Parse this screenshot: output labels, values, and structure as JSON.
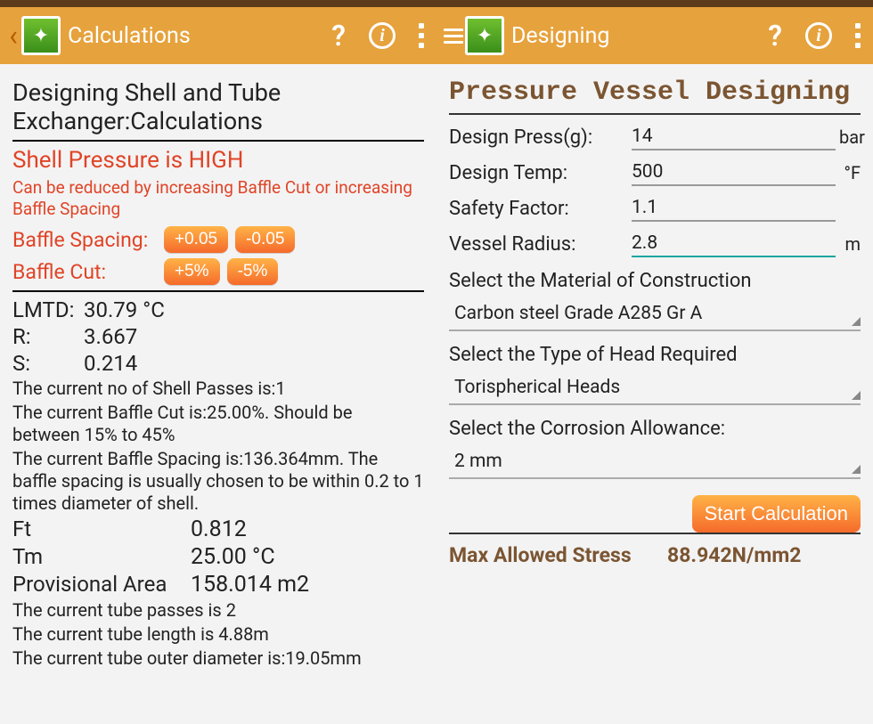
{
  "left": {
    "appbar_title": "Calculations",
    "heading": "Designing Shell and Tube Exchanger:Calculations",
    "warning_title": "Shell Pressure is HIGH",
    "warning_sub": "Can be reduced by increasing Baffle Cut or increasing Baffle Spacing",
    "baffle_spacing_label": "Baffle Spacing:",
    "baffle_spacing_plus": "+0.05",
    "baffle_spacing_minus": "-0.05",
    "baffle_cut_label": "Baffle Cut:",
    "baffle_cut_plus": "+5%",
    "baffle_cut_minus": "-5%",
    "lmtd_label": "LMTD:",
    "lmtd_value": "30.79 °C",
    "r_label": "R:",
    "r_value": "3.667",
    "s_label": "S:",
    "s_value": "0.214",
    "note_shell_passes": "The current no of Shell Passes is:1",
    "note_baffle_cut": "The current Baffle Cut is:25.00%. Should be between 15% to 45%",
    "note_baffle_spacing": "The current Baffle Spacing is:136.364mm. The baffle spacing is usually chosen to be within 0.2 to 1 times diameter of shell.",
    "ft_label": "Ft",
    "ft_value": "0.812",
    "tm_label": "Tm",
    "tm_value": "25.00 °C",
    "area_label": "Provisional Area",
    "area_value": "158.014 m2",
    "note_tube_passes": "The current tube passes is 2",
    "note_tube_length": "The current tube length is 4.88m",
    "note_tube_od": "The current tube outer diameter is:19.05mm"
  },
  "right": {
    "appbar_title": "Designing",
    "heading": "Pressure Vessel Designing",
    "fields": {
      "press_label": "Design Press(g):",
      "press_value": "14",
      "press_unit": "bar",
      "temp_label": "Design Temp:",
      "temp_value": "500",
      "temp_unit": "°F",
      "safety_label": "Safety Factor:",
      "safety_value": "1.1",
      "radius_label": "Vessel Radius:",
      "radius_value": "2.8",
      "radius_unit": "m"
    },
    "material_section": "Select the Material of Construction",
    "material_value": "Carbon steel Grade A285 Gr A",
    "head_section": "Select the Type of Head Required",
    "head_value": "Torispherical Heads",
    "corr_section": "Select the Corrosion Allowance:",
    "corr_value": "2 mm",
    "start_button": "Start Calculation",
    "result_label": "Max Allowed Stress",
    "result_value": "88.942N/mm2"
  }
}
